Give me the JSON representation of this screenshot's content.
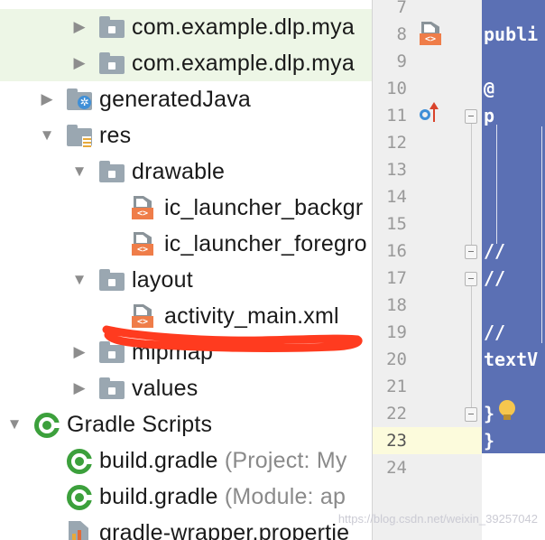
{
  "project_tree": {
    "rows": [
      {
        "kind": "folder",
        "expand": "collapsed",
        "label": "com.example.dlp.mya",
        "highlighted": true
      },
      {
        "kind": "folder",
        "expand": "collapsed",
        "label": "com.example.dlp.mya",
        "highlighted": true
      },
      {
        "kind": "folder-gen",
        "expand": "collapsed",
        "label": "generatedJava"
      },
      {
        "kind": "folder-res",
        "expand": "expanded",
        "label": "res"
      },
      {
        "kind": "folder",
        "expand": "expanded",
        "label": "drawable"
      },
      {
        "kind": "xml",
        "expand": "none",
        "label": "ic_launcher_backgr"
      },
      {
        "kind": "xml",
        "expand": "none",
        "label": "ic_launcher_foregro"
      },
      {
        "kind": "folder",
        "expand": "expanded",
        "label": "layout"
      },
      {
        "kind": "xml",
        "expand": "none",
        "label": "activity_main.xml"
      },
      {
        "kind": "folder",
        "expand": "collapsed",
        "label": "mipmap"
      },
      {
        "kind": "folder",
        "expand": "collapsed",
        "label": "values"
      },
      {
        "kind": "gradle-group",
        "expand": "expanded",
        "label": "Gradle Scripts"
      },
      {
        "kind": "gradle",
        "expand": "none",
        "label": "build.gradle",
        "sub": "(Project: My"
      },
      {
        "kind": "gradle",
        "expand": "none",
        "label": "build.gradle",
        "sub": "(Module: ap"
      },
      {
        "kind": "properties",
        "expand": "none",
        "label": "gradle-wrapper.propertie"
      }
    ]
  },
  "gutter": {
    "lines": [
      "7",
      "8",
      "9",
      "10",
      "11",
      "12",
      "13",
      "14",
      "15",
      "16",
      "17",
      "18",
      "19",
      "20",
      "21",
      "22",
      "23",
      "24"
    ],
    "current_line": "23"
  },
  "code": {
    "lines": [
      "",
      "publi",
      "",
      "  @",
      "  p",
      "",
      "",
      "",
      "",
      "//",
      "//",
      "",
      "//",
      "textV",
      "",
      "   }",
      "}",
      ""
    ]
  },
  "watermark": "https://blog.csdn.net/weixin_39257042",
  "colors": {
    "highlight_row": "#edf6e6",
    "code_background": "#5b70b4",
    "current_line": "#fcfbdc",
    "annotation": "#ff3b1f"
  }
}
